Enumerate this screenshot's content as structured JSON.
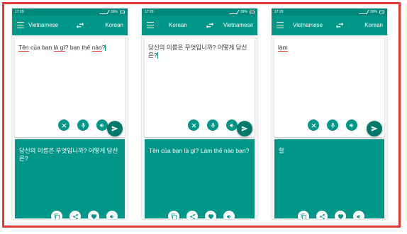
{
  "screens": [
    {
      "status_time": "17:29",
      "status_battery": "39%",
      "source_lang": "Vietnamese",
      "target_lang": "Korean",
      "input_plain": "",
      "input_underlined": "",
      "output_text": "당신의 이름은 무엇입니까? 어떻게 당신은?"
    },
    {
      "status_time": "17:29",
      "status_battery": "39%",
      "source_lang": "Korean",
      "target_lang": "Vietnamese",
      "input_plain": "당신의 이름은 무엇입니까? 어떻게 당신은?",
      "input_underlined": "",
      "output_text": "Tên của bạn là gì? Làm thế nào bạn?"
    },
    {
      "status_time": "17:29",
      "status_battery": "39%",
      "source_lang": "Vietnamese",
      "target_lang": "Korean",
      "input_plain": "",
      "input_underlined": "làm",
      "output_text": "할"
    }
  ],
  "screen1_input": {
    "w1": "Tên",
    "w2": " của bạn ",
    "w3": "là gì",
    "w4": "? bạn thế ",
    "w5": "nào",
    "w6": "?"
  },
  "icons": {
    "menu": "menu-icon",
    "swap": "swap-icon",
    "clear": "close-icon",
    "mic": "mic-icon",
    "speaker": "speaker-icon",
    "send": "send-icon",
    "copy": "copy-icon",
    "share": "share-icon",
    "favorite": "heart-icon"
  },
  "colors": {
    "primary": "#009688",
    "primary_dark": "#00796b",
    "status_bar": "#00897b",
    "frame_border": "#e53935"
  }
}
